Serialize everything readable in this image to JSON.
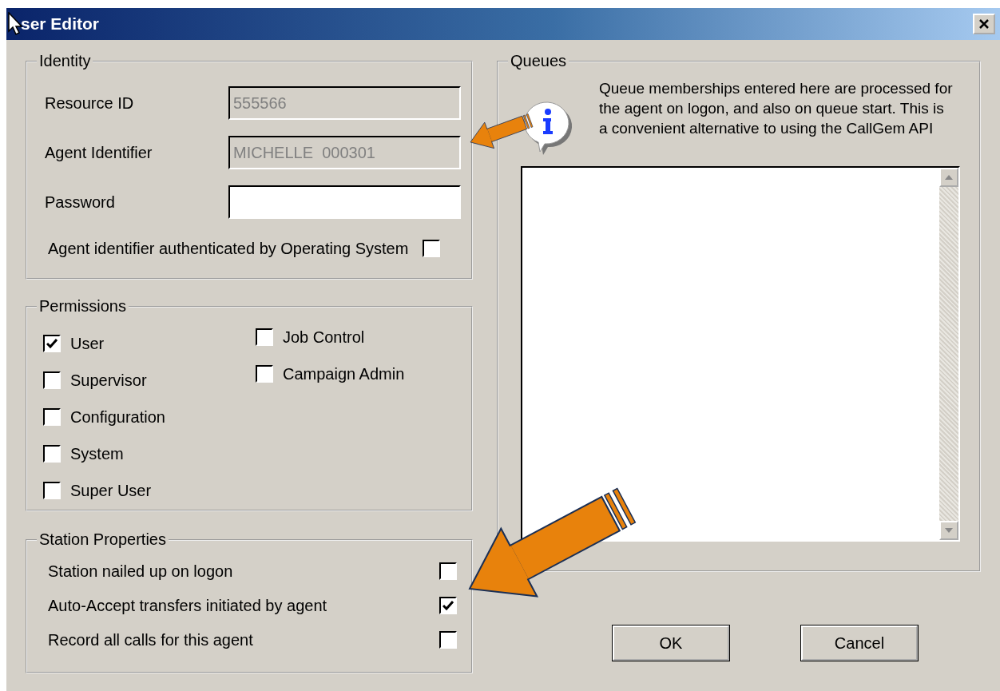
{
  "window": {
    "title": "ser Editor"
  },
  "identity": {
    "title": "Identity",
    "fields": [
      {
        "label": "Resource ID",
        "value": "555566",
        "disabled": true
      },
      {
        "label": "Agent Identifier",
        "value": "MICHELLE  000301",
        "disabled": true
      },
      {
        "label": "Password",
        "disabled": false
      }
    ],
    "option": {
      "label": "Agent identifier authenticated by Operating System",
      "checked": false
    }
  },
  "permissions": {
    "title": "Permissions",
    "columns": [
      [
        {
          "label": "User",
          "checked": true
        },
        {
          "label": "Supervisor",
          "checked": false
        },
        {
          "label": "Configuration",
          "checked": false
        },
        {
          "label": "System",
          "checked": false
        },
        {
          "label": "Super User",
          "checked": false
        }
      ],
      [
        {
          "label": "Job Control",
          "checked": false
        },
        {
          "label": "Campaign Admin",
          "checked": false
        }
      ]
    ]
  },
  "station": {
    "title": "Station Properties",
    "items": [
      {
        "label": "Station nailed up on logon",
        "checked": false
      },
      {
        "label": "Auto-Accept transfers initiated by agent",
        "checked": true
      },
      {
        "label": "Record all calls for this agent",
        "checked": false
      }
    ]
  },
  "queues": {
    "title": "Queues",
    "info": "Queue memberships entered here are processed for the agent on logon, and also on queue start. This is a convenient alternative to using the CallGem API"
  },
  "buttons": [
    "OK",
    "Cancel"
  ]
}
